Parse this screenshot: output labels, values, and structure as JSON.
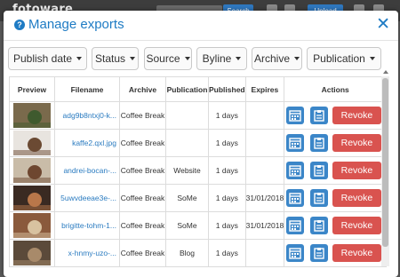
{
  "app": {
    "logo_text": "fotoware",
    "search_button": "Search",
    "upload_button": "Upload"
  },
  "dialog": {
    "title": "Manage exports",
    "help_icon_glyph": "?",
    "close_glyph": "✕"
  },
  "filters": [
    {
      "label": "Publish date"
    },
    {
      "label": "Status"
    },
    {
      "label": "Source"
    },
    {
      "label": "Byline"
    },
    {
      "label": "Archive"
    },
    {
      "label": "Publication"
    }
  ],
  "table": {
    "headers": [
      "Preview",
      "Filename",
      "Archive",
      "Publication",
      "Published",
      "Expires",
      "Actions"
    ],
    "revoke_label": "Revoke",
    "rows": [
      {
        "filename": "adg9b8ntxj0-k...",
        "archive": "Coffee Break",
        "publication": "",
        "published": "1 days",
        "expires": "",
        "thumb_color": "#7a6a4c",
        "thumb_accent": "#3f5a2e"
      },
      {
        "filename": "kaffe2.qxl.jpg",
        "archive": "Coffee Break",
        "publication": "",
        "published": "1 days",
        "expires": "",
        "thumb_color": "#e8e4df",
        "thumb_accent": "#6b4a33"
      },
      {
        "filename": "andrei-bocan-...",
        "archive": "Coffee Break",
        "publication": "Website",
        "published": "1 days",
        "expires": "",
        "thumb_color": "#c9bca8",
        "thumb_accent": "#6e4730"
      },
      {
        "filename": "5uwvdeeae3e-...",
        "archive": "Coffee Break",
        "publication": "SoMe",
        "published": "1 days",
        "expires": "31/01/2018",
        "thumb_color": "#3a2a22",
        "thumb_accent": "#b9774a"
      },
      {
        "filename": "brigitte-tohm-1...",
        "archive": "Coffee Break",
        "publication": "SoMe",
        "published": "1 days",
        "expires": "31/01/2018",
        "thumb_color": "#8a5a3c",
        "thumb_accent": "#d8c2a0"
      },
      {
        "filename": "x-hnmy-uzo-...",
        "archive": "Coffee Break",
        "publication": "Blog",
        "published": "1 days",
        "expires": "",
        "thumb_color": "#5b4a3a",
        "thumb_accent": "#a88a6a"
      }
    ]
  },
  "colors": {
    "accent": "#1e7bc4",
    "revoke": "#d9534f",
    "calendar_button": "#3b86c8"
  }
}
